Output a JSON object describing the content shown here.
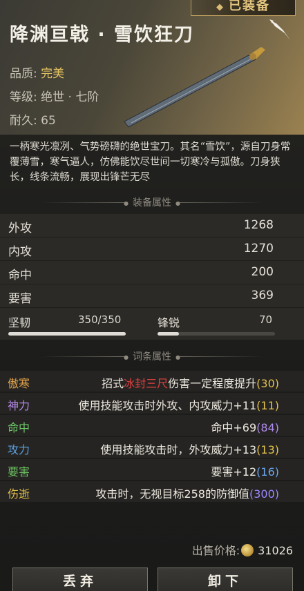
{
  "header": {
    "equipped_label": "已装备",
    "title": "降渊亘戟 · 雪饮狂刀",
    "quality_label": "品质:",
    "quality_value": "完美",
    "grade_label": "等级:",
    "grade_value": "绝世 · 七阶",
    "durability_label": "耐久:",
    "durability_value": "65"
  },
  "description": "一柄寒光凛冽、气势磅礴的绝世宝刀。其名“雪饮”，源自刀身常覆薄雪，寒气逼人，仿佛能饮尽世间一切寒冷与孤傲。刀身狭长，线条流畅，展现出锋芒无尽",
  "equip_section": {
    "title": "装备属性"
  },
  "stats": [
    {
      "label": "外攻",
      "value": "1268"
    },
    {
      "label": "内攻",
      "value": "1270"
    },
    {
      "label": "命中",
      "value": "200"
    },
    {
      "label": "要害",
      "value": "369"
    }
  ],
  "toughness": {
    "label": "坚韧",
    "value": "350/350",
    "fill": 1.0
  },
  "sharpness": {
    "label": "锋锐",
    "value": "70",
    "fill": 0.18
  },
  "affix_section": {
    "title": "词条属性"
  },
  "affixes": [
    {
      "tag": "傲寒",
      "pre": "招式",
      "hl": "冰封三尺",
      "post": "伤害一定程度提升",
      "num": "(30)"
    },
    {
      "tag": "神力",
      "pre": "使用技能攻击时外攻、内攻威力+11",
      "num": "(11)"
    },
    {
      "tag": "命中",
      "pre": "命中+69",
      "num": "(84)"
    },
    {
      "tag": "攻力",
      "pre": "使用技能攻击时，外攻威力+13",
      "num": "(13)"
    },
    {
      "tag": "要害",
      "pre": "要害+12",
      "num": "(16)"
    },
    {
      "tag": "伤逝",
      "pre": "攻击时，无视目标258的防御值",
      "num": "(300)"
    }
  ],
  "price": {
    "label": "出售价格:",
    "value": "31026"
  },
  "buttons": {
    "discard": "丢弃",
    "unequip": "卸下"
  }
}
